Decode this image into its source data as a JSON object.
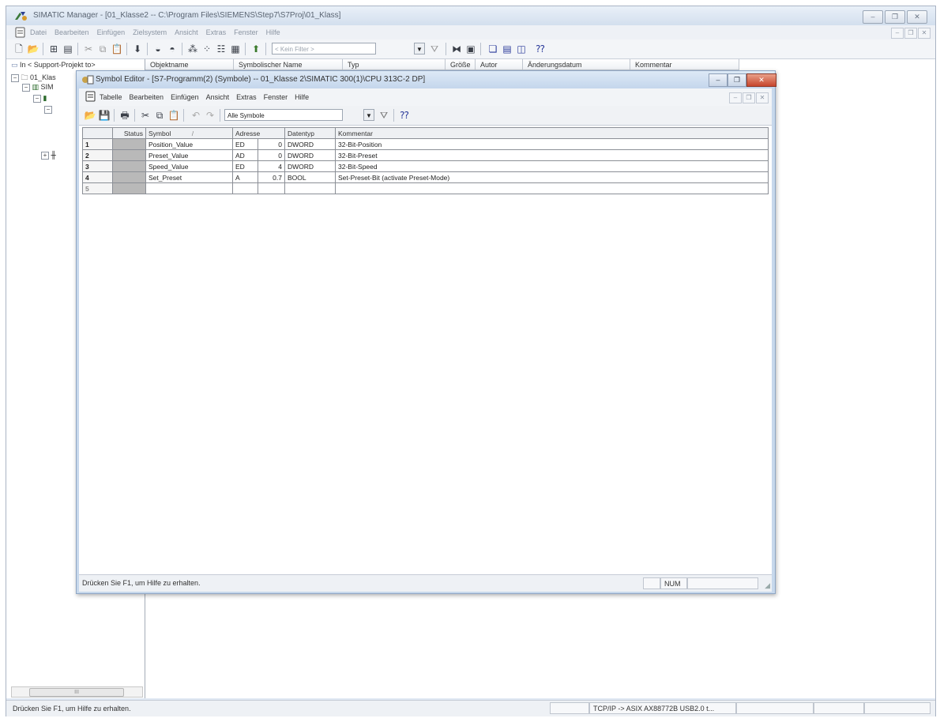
{
  "manager": {
    "title": "SIMATIC Manager - [01_Klasse2 -- C:\\Program Files\\SIEMENS\\Step7\\S7Proj\\01_Klass]",
    "menu": [
      "Datei",
      "Bearbeiten",
      "Einfügen",
      "Zielsystem",
      "Ansicht",
      "Extras",
      "Fenster",
      "Hilfe"
    ],
    "filter_value": "< Kein Filter >",
    "tree": {
      "root_label": "In < Support-Projekt to>",
      "project_label": "01_Klas",
      "station_label": "SIM"
    },
    "list_columns": [
      "Objektname",
      "Symbolischer Name",
      "Typ",
      "Größe",
      "Autor",
      "Änderungsdatum",
      "Kommentar"
    ],
    "status_text": "Drücken Sie F1, um Hilfe zu erhalten.",
    "status_connection": "TCP/IP -> ASIX AX88772B USB2.0 t..."
  },
  "symbol_editor": {
    "title": "Symbol Editor - [S7-Programm(2) (Symbole) -- 01_Klasse 2\\SIMATIC 300(1)\\CPU 313C-2 DP]",
    "menu": [
      "Tabelle",
      "Bearbeiten",
      "Einfügen",
      "Ansicht",
      "Extras",
      "Fenster",
      "Hilfe"
    ],
    "filter_value": "Alle Symbole",
    "columns": {
      "status": "Status",
      "symbol": "Symbol",
      "sort_marker": "/",
      "address": "Adresse",
      "datatype": "Datentyp",
      "comment": "Kommentar"
    },
    "rows": [
      {
        "num": "1",
        "symbol": "Position_Value",
        "addr_op": "ED",
        "addr_num": "0",
        "datatype": "DWORD",
        "comment": "32-Bit-Position"
      },
      {
        "num": "2",
        "symbol": "Preset_Value",
        "addr_op": "AD",
        "addr_num": "0",
        "datatype": "DWORD",
        "comment": "32-Bit-Preset"
      },
      {
        "num": "3",
        "symbol": "Speed_Value",
        "addr_op": "ED",
        "addr_num": "4",
        "datatype": "DWORD",
        "comment": "32-Bit-Speed"
      },
      {
        "num": "4",
        "symbol": "Set_Preset",
        "addr_op": "A",
        "addr_num": "0.7",
        "datatype": "BOOL",
        "comment": "Set-Preset-Bit (activate Preset-Mode)"
      },
      {
        "num": "5",
        "symbol": "",
        "addr_op": "",
        "addr_num": "",
        "datatype": "",
        "comment": ""
      }
    ],
    "status_text": "Drücken Sie F1, um Hilfe zu erhalten.",
    "status_num": "NUM"
  }
}
